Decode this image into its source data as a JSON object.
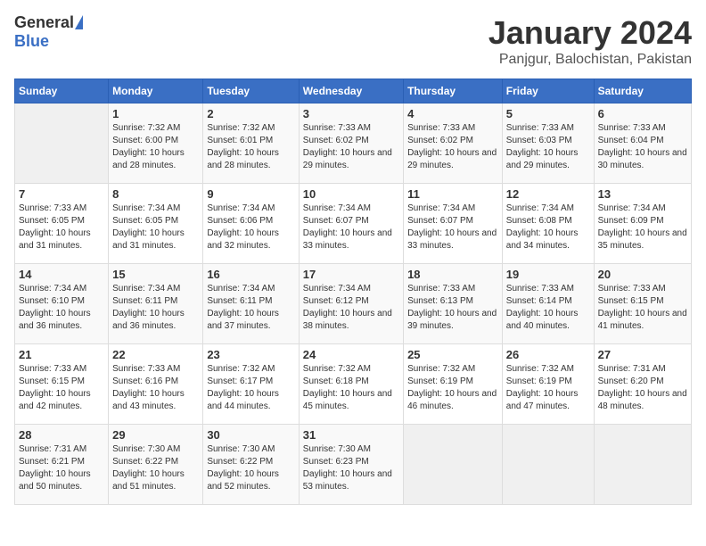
{
  "logo": {
    "text1": "General",
    "text2": "Blue"
  },
  "title": "January 2024",
  "location": "Panjgur, Balochistan, Pakistan",
  "headers": [
    "Sunday",
    "Monday",
    "Tuesday",
    "Wednesday",
    "Thursday",
    "Friday",
    "Saturday"
  ],
  "weeks": [
    [
      {
        "day": "",
        "sunrise": "",
        "sunset": "",
        "daylight": ""
      },
      {
        "day": "1",
        "sunrise": "Sunrise: 7:32 AM",
        "sunset": "Sunset: 6:00 PM",
        "daylight": "Daylight: 10 hours and 28 minutes."
      },
      {
        "day": "2",
        "sunrise": "Sunrise: 7:32 AM",
        "sunset": "Sunset: 6:01 PM",
        "daylight": "Daylight: 10 hours and 28 minutes."
      },
      {
        "day": "3",
        "sunrise": "Sunrise: 7:33 AM",
        "sunset": "Sunset: 6:02 PM",
        "daylight": "Daylight: 10 hours and 29 minutes."
      },
      {
        "day": "4",
        "sunrise": "Sunrise: 7:33 AM",
        "sunset": "Sunset: 6:02 PM",
        "daylight": "Daylight: 10 hours and 29 minutes."
      },
      {
        "day": "5",
        "sunrise": "Sunrise: 7:33 AM",
        "sunset": "Sunset: 6:03 PM",
        "daylight": "Daylight: 10 hours and 29 minutes."
      },
      {
        "day": "6",
        "sunrise": "Sunrise: 7:33 AM",
        "sunset": "Sunset: 6:04 PM",
        "daylight": "Daylight: 10 hours and 30 minutes."
      }
    ],
    [
      {
        "day": "7",
        "sunrise": "Sunrise: 7:33 AM",
        "sunset": "Sunset: 6:05 PM",
        "daylight": "Daylight: 10 hours and 31 minutes."
      },
      {
        "day": "8",
        "sunrise": "Sunrise: 7:34 AM",
        "sunset": "Sunset: 6:05 PM",
        "daylight": "Daylight: 10 hours and 31 minutes."
      },
      {
        "day": "9",
        "sunrise": "Sunrise: 7:34 AM",
        "sunset": "Sunset: 6:06 PM",
        "daylight": "Daylight: 10 hours and 32 minutes."
      },
      {
        "day": "10",
        "sunrise": "Sunrise: 7:34 AM",
        "sunset": "Sunset: 6:07 PM",
        "daylight": "Daylight: 10 hours and 33 minutes."
      },
      {
        "day": "11",
        "sunrise": "Sunrise: 7:34 AM",
        "sunset": "Sunset: 6:07 PM",
        "daylight": "Daylight: 10 hours and 33 minutes."
      },
      {
        "day": "12",
        "sunrise": "Sunrise: 7:34 AM",
        "sunset": "Sunset: 6:08 PM",
        "daylight": "Daylight: 10 hours and 34 minutes."
      },
      {
        "day": "13",
        "sunrise": "Sunrise: 7:34 AM",
        "sunset": "Sunset: 6:09 PM",
        "daylight": "Daylight: 10 hours and 35 minutes."
      }
    ],
    [
      {
        "day": "14",
        "sunrise": "Sunrise: 7:34 AM",
        "sunset": "Sunset: 6:10 PM",
        "daylight": "Daylight: 10 hours and 36 minutes."
      },
      {
        "day": "15",
        "sunrise": "Sunrise: 7:34 AM",
        "sunset": "Sunset: 6:11 PM",
        "daylight": "Daylight: 10 hours and 36 minutes."
      },
      {
        "day": "16",
        "sunrise": "Sunrise: 7:34 AM",
        "sunset": "Sunset: 6:11 PM",
        "daylight": "Daylight: 10 hours and 37 minutes."
      },
      {
        "day": "17",
        "sunrise": "Sunrise: 7:34 AM",
        "sunset": "Sunset: 6:12 PM",
        "daylight": "Daylight: 10 hours and 38 minutes."
      },
      {
        "day": "18",
        "sunrise": "Sunrise: 7:33 AM",
        "sunset": "Sunset: 6:13 PM",
        "daylight": "Daylight: 10 hours and 39 minutes."
      },
      {
        "day": "19",
        "sunrise": "Sunrise: 7:33 AM",
        "sunset": "Sunset: 6:14 PM",
        "daylight": "Daylight: 10 hours and 40 minutes."
      },
      {
        "day": "20",
        "sunrise": "Sunrise: 7:33 AM",
        "sunset": "Sunset: 6:15 PM",
        "daylight": "Daylight: 10 hours and 41 minutes."
      }
    ],
    [
      {
        "day": "21",
        "sunrise": "Sunrise: 7:33 AM",
        "sunset": "Sunset: 6:15 PM",
        "daylight": "Daylight: 10 hours and 42 minutes."
      },
      {
        "day": "22",
        "sunrise": "Sunrise: 7:33 AM",
        "sunset": "Sunset: 6:16 PM",
        "daylight": "Daylight: 10 hours and 43 minutes."
      },
      {
        "day": "23",
        "sunrise": "Sunrise: 7:32 AM",
        "sunset": "Sunset: 6:17 PM",
        "daylight": "Daylight: 10 hours and 44 minutes."
      },
      {
        "day": "24",
        "sunrise": "Sunrise: 7:32 AM",
        "sunset": "Sunset: 6:18 PM",
        "daylight": "Daylight: 10 hours and 45 minutes."
      },
      {
        "day": "25",
        "sunrise": "Sunrise: 7:32 AM",
        "sunset": "Sunset: 6:19 PM",
        "daylight": "Daylight: 10 hours and 46 minutes."
      },
      {
        "day": "26",
        "sunrise": "Sunrise: 7:32 AM",
        "sunset": "Sunset: 6:19 PM",
        "daylight": "Daylight: 10 hours and 47 minutes."
      },
      {
        "day": "27",
        "sunrise": "Sunrise: 7:31 AM",
        "sunset": "Sunset: 6:20 PM",
        "daylight": "Daylight: 10 hours and 48 minutes."
      }
    ],
    [
      {
        "day": "28",
        "sunrise": "Sunrise: 7:31 AM",
        "sunset": "Sunset: 6:21 PM",
        "daylight": "Daylight: 10 hours and 50 minutes."
      },
      {
        "day": "29",
        "sunrise": "Sunrise: 7:30 AM",
        "sunset": "Sunset: 6:22 PM",
        "daylight": "Daylight: 10 hours and 51 minutes."
      },
      {
        "day": "30",
        "sunrise": "Sunrise: 7:30 AM",
        "sunset": "Sunset: 6:22 PM",
        "daylight": "Daylight: 10 hours and 52 minutes."
      },
      {
        "day": "31",
        "sunrise": "Sunrise: 7:30 AM",
        "sunset": "Sunset: 6:23 PM",
        "daylight": "Daylight: 10 hours and 53 minutes."
      },
      {
        "day": "",
        "sunrise": "",
        "sunset": "",
        "daylight": ""
      },
      {
        "day": "",
        "sunrise": "",
        "sunset": "",
        "daylight": ""
      },
      {
        "day": "",
        "sunrise": "",
        "sunset": "",
        "daylight": ""
      }
    ]
  ]
}
